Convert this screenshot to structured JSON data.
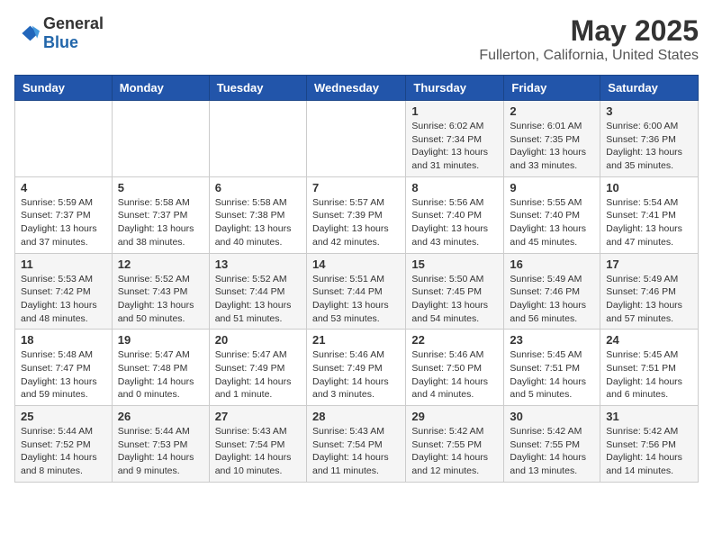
{
  "header": {
    "logo_general": "General",
    "logo_blue": "Blue",
    "title": "May 2025",
    "subtitle": "Fullerton, California, United States"
  },
  "weekdays": [
    "Sunday",
    "Monday",
    "Tuesday",
    "Wednesday",
    "Thursday",
    "Friday",
    "Saturday"
  ],
  "weeks": [
    [
      {
        "day": "",
        "info": ""
      },
      {
        "day": "",
        "info": ""
      },
      {
        "day": "",
        "info": ""
      },
      {
        "day": "",
        "info": ""
      },
      {
        "day": "1",
        "info": "Sunrise: 6:02 AM\nSunset: 7:34 PM\nDaylight: 13 hours\nand 31 minutes."
      },
      {
        "day": "2",
        "info": "Sunrise: 6:01 AM\nSunset: 7:35 PM\nDaylight: 13 hours\nand 33 minutes."
      },
      {
        "day": "3",
        "info": "Sunrise: 6:00 AM\nSunset: 7:36 PM\nDaylight: 13 hours\nand 35 minutes."
      }
    ],
    [
      {
        "day": "4",
        "info": "Sunrise: 5:59 AM\nSunset: 7:37 PM\nDaylight: 13 hours\nand 37 minutes."
      },
      {
        "day": "5",
        "info": "Sunrise: 5:58 AM\nSunset: 7:37 PM\nDaylight: 13 hours\nand 38 minutes."
      },
      {
        "day": "6",
        "info": "Sunrise: 5:58 AM\nSunset: 7:38 PM\nDaylight: 13 hours\nand 40 minutes."
      },
      {
        "day": "7",
        "info": "Sunrise: 5:57 AM\nSunset: 7:39 PM\nDaylight: 13 hours\nand 42 minutes."
      },
      {
        "day": "8",
        "info": "Sunrise: 5:56 AM\nSunset: 7:40 PM\nDaylight: 13 hours\nand 43 minutes."
      },
      {
        "day": "9",
        "info": "Sunrise: 5:55 AM\nSunset: 7:40 PM\nDaylight: 13 hours\nand 45 minutes."
      },
      {
        "day": "10",
        "info": "Sunrise: 5:54 AM\nSunset: 7:41 PM\nDaylight: 13 hours\nand 47 minutes."
      }
    ],
    [
      {
        "day": "11",
        "info": "Sunrise: 5:53 AM\nSunset: 7:42 PM\nDaylight: 13 hours\nand 48 minutes."
      },
      {
        "day": "12",
        "info": "Sunrise: 5:52 AM\nSunset: 7:43 PM\nDaylight: 13 hours\nand 50 minutes."
      },
      {
        "day": "13",
        "info": "Sunrise: 5:52 AM\nSunset: 7:44 PM\nDaylight: 13 hours\nand 51 minutes."
      },
      {
        "day": "14",
        "info": "Sunrise: 5:51 AM\nSunset: 7:44 PM\nDaylight: 13 hours\nand 53 minutes."
      },
      {
        "day": "15",
        "info": "Sunrise: 5:50 AM\nSunset: 7:45 PM\nDaylight: 13 hours\nand 54 minutes."
      },
      {
        "day": "16",
        "info": "Sunrise: 5:49 AM\nSunset: 7:46 PM\nDaylight: 13 hours\nand 56 minutes."
      },
      {
        "day": "17",
        "info": "Sunrise: 5:49 AM\nSunset: 7:46 PM\nDaylight: 13 hours\nand 57 minutes."
      }
    ],
    [
      {
        "day": "18",
        "info": "Sunrise: 5:48 AM\nSunset: 7:47 PM\nDaylight: 13 hours\nand 59 minutes."
      },
      {
        "day": "19",
        "info": "Sunrise: 5:47 AM\nSunset: 7:48 PM\nDaylight: 14 hours\nand 0 minutes."
      },
      {
        "day": "20",
        "info": "Sunrise: 5:47 AM\nSunset: 7:49 PM\nDaylight: 14 hours\nand 1 minute."
      },
      {
        "day": "21",
        "info": "Sunrise: 5:46 AM\nSunset: 7:49 PM\nDaylight: 14 hours\nand 3 minutes."
      },
      {
        "day": "22",
        "info": "Sunrise: 5:46 AM\nSunset: 7:50 PM\nDaylight: 14 hours\nand 4 minutes."
      },
      {
        "day": "23",
        "info": "Sunrise: 5:45 AM\nSunset: 7:51 PM\nDaylight: 14 hours\nand 5 minutes."
      },
      {
        "day": "24",
        "info": "Sunrise: 5:45 AM\nSunset: 7:51 PM\nDaylight: 14 hours\nand 6 minutes."
      }
    ],
    [
      {
        "day": "25",
        "info": "Sunrise: 5:44 AM\nSunset: 7:52 PM\nDaylight: 14 hours\nand 8 minutes."
      },
      {
        "day": "26",
        "info": "Sunrise: 5:44 AM\nSunset: 7:53 PM\nDaylight: 14 hours\nand 9 minutes."
      },
      {
        "day": "27",
        "info": "Sunrise: 5:43 AM\nSunset: 7:54 PM\nDaylight: 14 hours\nand 10 minutes."
      },
      {
        "day": "28",
        "info": "Sunrise: 5:43 AM\nSunset: 7:54 PM\nDaylight: 14 hours\nand 11 minutes."
      },
      {
        "day": "29",
        "info": "Sunrise: 5:42 AM\nSunset: 7:55 PM\nDaylight: 14 hours\nand 12 minutes."
      },
      {
        "day": "30",
        "info": "Sunrise: 5:42 AM\nSunset: 7:55 PM\nDaylight: 14 hours\nand 13 minutes."
      },
      {
        "day": "31",
        "info": "Sunrise: 5:42 AM\nSunset: 7:56 PM\nDaylight: 14 hours\nand 14 minutes."
      }
    ]
  ]
}
